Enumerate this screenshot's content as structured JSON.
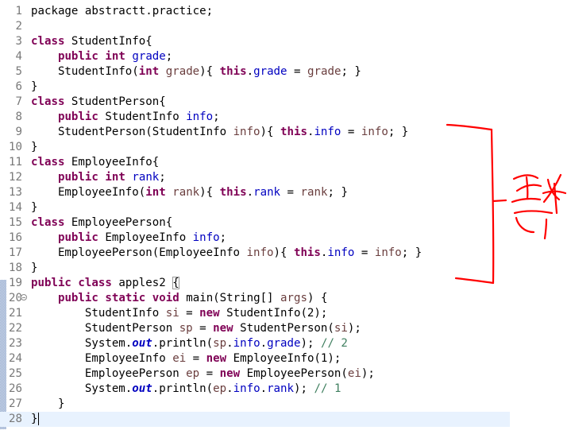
{
  "editor": {
    "lines": [
      {
        "num": "1",
        "tokens": [
          {
            "t": "package abstractt.practice;",
            "c": "ptx"
          }
        ]
      },
      {
        "num": "2",
        "tokens": []
      },
      {
        "num": "3",
        "tokens": [
          {
            "t": "class",
            "c": "kw"
          },
          {
            "t": " StudentInfo{",
            "c": "ptx"
          }
        ]
      },
      {
        "num": "4",
        "tokens": [
          {
            "t": "    ",
            "c": "ptx"
          },
          {
            "t": "public",
            "c": "kw"
          },
          {
            "t": " ",
            "c": "ptx"
          },
          {
            "t": "int",
            "c": "kw"
          },
          {
            "t": " ",
            "c": "ptx"
          },
          {
            "t": "grade",
            "c": "fld"
          },
          {
            "t": ";",
            "c": "ptx"
          }
        ]
      },
      {
        "num": "5",
        "tokens": [
          {
            "t": "    StudentInfo(",
            "c": "ptx"
          },
          {
            "t": "int",
            "c": "kw"
          },
          {
            "t": " ",
            "c": "ptx"
          },
          {
            "t": "grade",
            "c": "param"
          },
          {
            "t": "){ ",
            "c": "ptx"
          },
          {
            "t": "this",
            "c": "kw"
          },
          {
            "t": ".",
            "c": "ptx"
          },
          {
            "t": "grade",
            "c": "fld"
          },
          {
            "t": " = ",
            "c": "ptx"
          },
          {
            "t": "grade",
            "c": "param"
          },
          {
            "t": "; }",
            "c": "ptx"
          }
        ]
      },
      {
        "num": "6",
        "tokens": [
          {
            "t": "}",
            "c": "ptx"
          }
        ]
      },
      {
        "num": "7",
        "tokens": [
          {
            "t": "class",
            "c": "kw"
          },
          {
            "t": " StudentPerson{",
            "c": "ptx"
          }
        ]
      },
      {
        "num": "8",
        "tokens": [
          {
            "t": "    ",
            "c": "ptx"
          },
          {
            "t": "public",
            "c": "kw"
          },
          {
            "t": " StudentInfo ",
            "c": "ptx"
          },
          {
            "t": "info",
            "c": "fld"
          },
          {
            "t": ";",
            "c": "ptx"
          }
        ]
      },
      {
        "num": "9",
        "tokens": [
          {
            "t": "    StudentPerson(StudentInfo ",
            "c": "ptx"
          },
          {
            "t": "info",
            "c": "param"
          },
          {
            "t": "){ ",
            "c": "ptx"
          },
          {
            "t": "this",
            "c": "kw"
          },
          {
            "t": ".",
            "c": "ptx"
          },
          {
            "t": "info",
            "c": "fld"
          },
          {
            "t": " = ",
            "c": "ptx"
          },
          {
            "t": "info",
            "c": "param"
          },
          {
            "t": "; }",
            "c": "ptx"
          }
        ]
      },
      {
        "num": "10",
        "tokens": [
          {
            "t": "}",
            "c": "ptx"
          }
        ]
      },
      {
        "num": "11",
        "tokens": [
          {
            "t": "class",
            "c": "kw"
          },
          {
            "t": " EmployeeInfo{",
            "c": "ptx"
          }
        ]
      },
      {
        "num": "12",
        "tokens": [
          {
            "t": "    ",
            "c": "ptx"
          },
          {
            "t": "public",
            "c": "kw"
          },
          {
            "t": " ",
            "c": "ptx"
          },
          {
            "t": "int",
            "c": "kw"
          },
          {
            "t": " ",
            "c": "ptx"
          },
          {
            "t": "rank",
            "c": "fld"
          },
          {
            "t": ";",
            "c": "ptx"
          }
        ]
      },
      {
        "num": "13",
        "tokens": [
          {
            "t": "    EmployeeInfo(",
            "c": "ptx"
          },
          {
            "t": "int",
            "c": "kw"
          },
          {
            "t": " ",
            "c": "ptx"
          },
          {
            "t": "rank",
            "c": "param"
          },
          {
            "t": "){ ",
            "c": "ptx"
          },
          {
            "t": "this",
            "c": "kw"
          },
          {
            "t": ".",
            "c": "ptx"
          },
          {
            "t": "rank",
            "c": "fld"
          },
          {
            "t": " = ",
            "c": "ptx"
          },
          {
            "t": "rank",
            "c": "param"
          },
          {
            "t": "; }",
            "c": "ptx"
          }
        ]
      },
      {
        "num": "14",
        "tokens": [
          {
            "t": "}",
            "c": "ptx"
          }
        ]
      },
      {
        "num": "15",
        "tokens": [
          {
            "t": "class",
            "c": "kw"
          },
          {
            "t": " EmployeePerson{",
            "c": "ptx"
          }
        ]
      },
      {
        "num": "16",
        "tokens": [
          {
            "t": "    ",
            "c": "ptx"
          },
          {
            "t": "public",
            "c": "kw"
          },
          {
            "t": " EmployeeInfo ",
            "c": "ptx"
          },
          {
            "t": "info",
            "c": "fld"
          },
          {
            "t": ";",
            "c": "ptx"
          }
        ]
      },
      {
        "num": "17",
        "tokens": [
          {
            "t": "    EmployeePerson(EmployeeInfo ",
            "c": "ptx"
          },
          {
            "t": "info",
            "c": "param"
          },
          {
            "t": "){ ",
            "c": "ptx"
          },
          {
            "t": "this",
            "c": "kw"
          },
          {
            "t": ".",
            "c": "ptx"
          },
          {
            "t": "info",
            "c": "fld"
          },
          {
            "t": " = ",
            "c": "ptx"
          },
          {
            "t": "info",
            "c": "param"
          },
          {
            "t": "; }",
            "c": "ptx"
          }
        ]
      },
      {
        "num": "18",
        "tokens": [
          {
            "t": "}",
            "c": "ptx"
          }
        ]
      },
      {
        "num": "19",
        "tokens": [
          {
            "t": "public",
            "c": "kw"
          },
          {
            "t": " ",
            "c": "ptx"
          },
          {
            "t": "class",
            "c": "kw"
          },
          {
            "t": " apples2 {",
            "c": "ptx"
          }
        ]
      },
      {
        "num": "20",
        "tokens": [
          {
            "t": "    ",
            "c": "ptx"
          },
          {
            "t": "public",
            "c": "kw"
          },
          {
            "t": " ",
            "c": "ptx"
          },
          {
            "t": "static",
            "c": "kw"
          },
          {
            "t": " ",
            "c": "ptx"
          },
          {
            "t": "void",
            "c": "kw"
          },
          {
            "t": " main(String[] ",
            "c": "ptx"
          },
          {
            "t": "args",
            "c": "param"
          },
          {
            "t": ") {",
            "c": "ptx"
          }
        ]
      },
      {
        "num": "21",
        "tokens": [
          {
            "t": "        StudentInfo ",
            "c": "ptx"
          },
          {
            "t": "si",
            "c": "param"
          },
          {
            "t": " = ",
            "c": "ptx"
          },
          {
            "t": "new",
            "c": "kw"
          },
          {
            "t": " StudentInfo(2);",
            "c": "ptx"
          }
        ]
      },
      {
        "num": "22",
        "tokens": [
          {
            "t": "        StudentPerson ",
            "c": "ptx"
          },
          {
            "t": "sp",
            "c": "param"
          },
          {
            "t": " = ",
            "c": "ptx"
          },
          {
            "t": "new",
            "c": "kw"
          },
          {
            "t": " StudentPerson(",
            "c": "ptx"
          },
          {
            "t": "si",
            "c": "param"
          },
          {
            "t": ");",
            "c": "ptx"
          }
        ]
      },
      {
        "num": "23",
        "tokens": [
          {
            "t": "        System.",
            "c": "ptx"
          },
          {
            "t": "out",
            "c": "static-fld"
          },
          {
            "t": ".println(",
            "c": "ptx"
          },
          {
            "t": "sp",
            "c": "param"
          },
          {
            "t": ".",
            "c": "ptx"
          },
          {
            "t": "info",
            "c": "fld"
          },
          {
            "t": ".",
            "c": "ptx"
          },
          {
            "t": "grade",
            "c": "fld"
          },
          {
            "t": "); ",
            "c": "ptx"
          },
          {
            "t": "// 2",
            "c": "cmt"
          }
        ]
      },
      {
        "num": "24",
        "tokens": [
          {
            "t": "        EmployeeInfo ",
            "c": "ptx"
          },
          {
            "t": "ei",
            "c": "param"
          },
          {
            "t": " = ",
            "c": "ptx"
          },
          {
            "t": "new",
            "c": "kw"
          },
          {
            "t": " EmployeeInfo(1);",
            "c": "ptx"
          }
        ]
      },
      {
        "num": "25",
        "tokens": [
          {
            "t": "        EmployeePerson ",
            "c": "ptx"
          },
          {
            "t": "ep",
            "c": "param"
          },
          {
            "t": " = ",
            "c": "ptx"
          },
          {
            "t": "new",
            "c": "kw"
          },
          {
            "t": " EmployeePerson(",
            "c": "ptx"
          },
          {
            "t": "ei",
            "c": "param"
          },
          {
            "t": ");",
            "c": "ptx"
          }
        ]
      },
      {
        "num": "26",
        "tokens": [
          {
            "t": "        System.",
            "c": "ptx"
          },
          {
            "t": "out",
            "c": "static-fld"
          },
          {
            "t": ".println(",
            "c": "ptx"
          },
          {
            "t": "ep",
            "c": "param"
          },
          {
            "t": ".",
            "c": "ptx"
          },
          {
            "t": "info",
            "c": "fld"
          },
          {
            "t": ".",
            "c": "ptx"
          },
          {
            "t": "rank",
            "c": "fld"
          },
          {
            "t": "); ",
            "c": "ptx"
          },
          {
            "t": "// 1",
            "c": "cmt"
          }
        ]
      },
      {
        "num": "27",
        "tokens": [
          {
            "t": "    }",
            "c": "ptx"
          }
        ]
      },
      {
        "num": "28",
        "tokens": [
          {
            "t": "}",
            "c": "ptx"
          }
        ]
      }
    ],
    "current_line": "28",
    "colors": {
      "keyword": "#7f0055",
      "field": "#0000c0",
      "parameter": "#6a3e3e",
      "comment": "#3f7f5f",
      "line_number": "#787878",
      "current_line_bg": "#e8f2fe",
      "annotation_ink": "#ff0000"
    }
  },
  "annotation": {
    "type": "handwritten red bracket with scribble",
    "icon": "handwritten-annotation-icon"
  }
}
